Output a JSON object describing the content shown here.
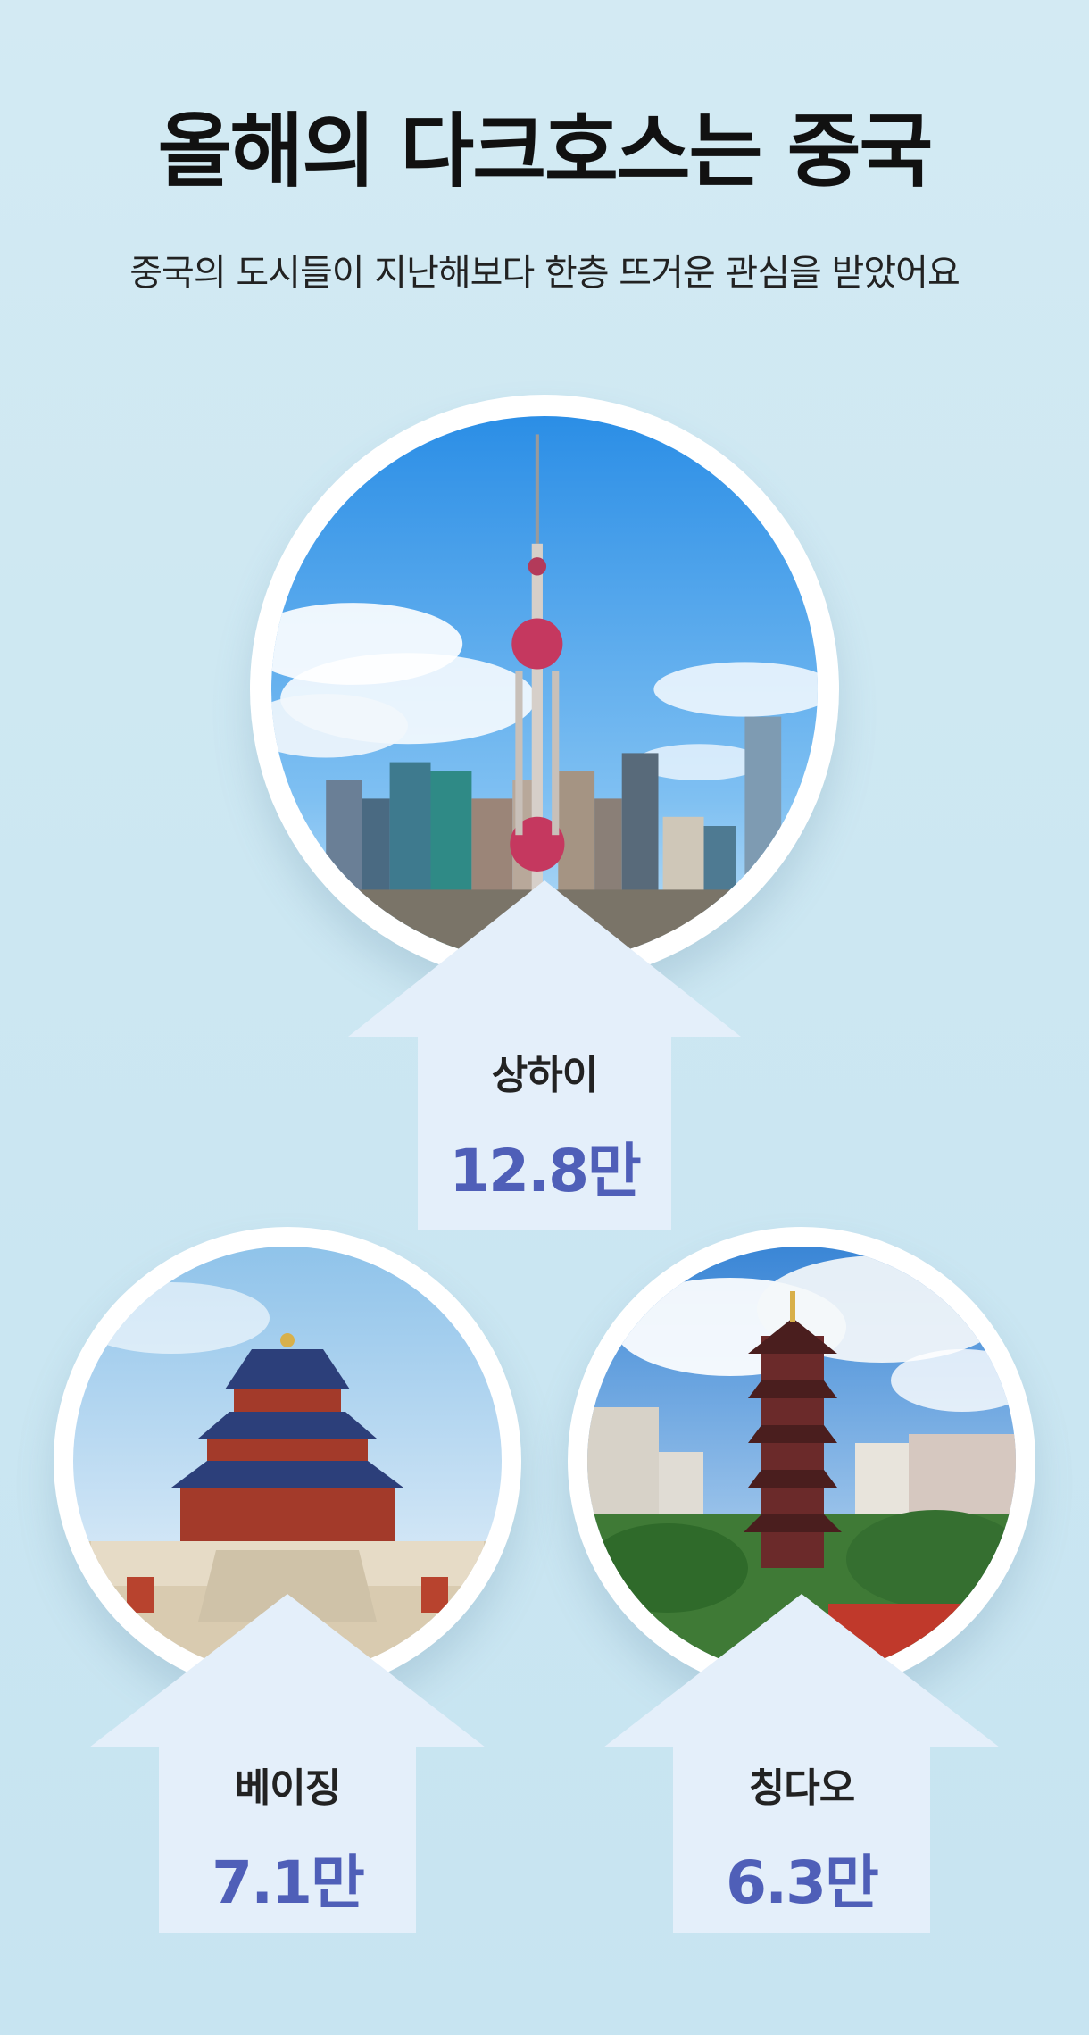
{
  "header": {
    "title": "올해의 다크호스는 중국",
    "subtitle": "중국의 도시들이 지난해보다 한층 뜨거운 관심을 받았어요"
  },
  "cities": [
    {
      "name": "상하이",
      "value": "12.8만"
    },
    {
      "name": "베이징",
      "value": "7.1만"
    },
    {
      "name": "칭다오",
      "value": "6.3만"
    }
  ],
  "colors": {
    "value_text": "#4f5fb8",
    "arrow_fill": "#e4effa",
    "background": "#cfe8f3"
  }
}
